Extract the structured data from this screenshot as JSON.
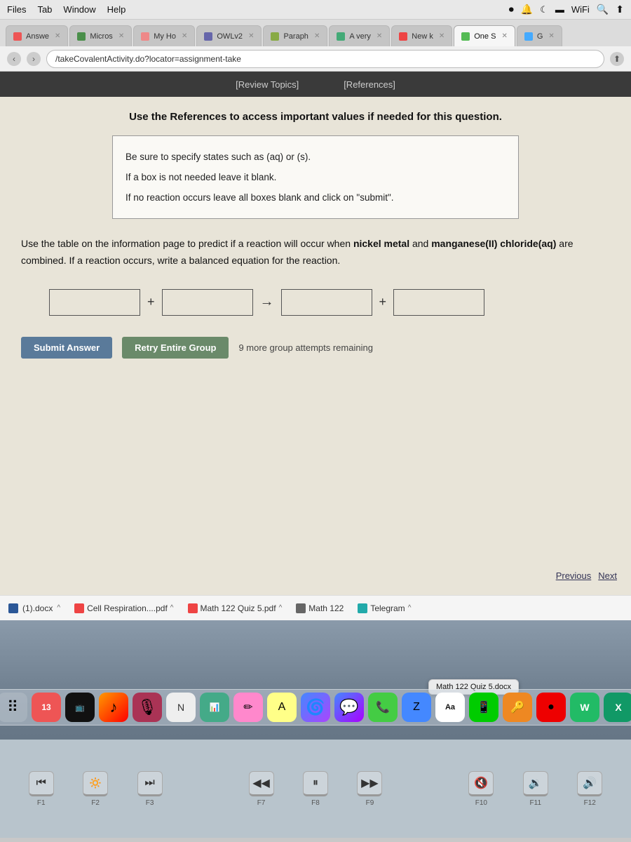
{
  "menubar": {
    "items": [
      "Files",
      "Tab",
      "Window",
      "Help"
    ]
  },
  "tabs": [
    {
      "id": "answe",
      "label": "Answe",
      "active": false,
      "favicon": "A"
    },
    {
      "id": "micros",
      "label": "Micros",
      "active": false,
      "favicon": "M"
    },
    {
      "id": "myho",
      "label": "My Ho",
      "active": false,
      "favicon": "H"
    },
    {
      "id": "owlv",
      "label": "OWLv2",
      "active": false,
      "favicon": "O"
    },
    {
      "id": "paraph",
      "label": "Paraph",
      "active": false,
      "favicon": "P"
    },
    {
      "id": "avery",
      "label": "A very",
      "active": false,
      "favicon": "A"
    },
    {
      "id": "newk",
      "label": "New k",
      "active": false,
      "favicon": "N"
    },
    {
      "id": "ones",
      "label": "One S",
      "active": true,
      "favicon": "E"
    },
    {
      "id": "g",
      "label": "G",
      "active": false,
      "favicon": "G"
    }
  ],
  "address_bar": {
    "url": "/takeCovalentActivity.do?locator=assignment-take"
  },
  "owl_toolbar": {
    "review_topics": "[Review Topics]",
    "references": "[References]"
  },
  "page": {
    "instruction_header": "Use the References to access important values if needed for this question.",
    "instructions": [
      "Be sure to specify states such as (aq) or (s).",
      "If a box is not needed leave it blank.",
      "If no reaction occurs leave all boxes blank and click on \"submit\"."
    ],
    "question_text_part1": "Use the table on the information page to predict if a reaction will occur when ",
    "question_bold1": "nickel metal",
    "question_text_part2": " and ",
    "question_bold2": "manganese(II) chloride(aq)",
    "question_text_part3": " are combined. If a reaction occurs, write a balanced equation for the reaction.",
    "equation": {
      "plus1": "+",
      "arrow": "→",
      "plus2": "+"
    },
    "buttons": {
      "submit": "Submit Answer",
      "retry": "Retry Entire Group",
      "attempts": "9 more group attempts remaining"
    },
    "navigation": {
      "previous": "Previous",
      "next": "Next"
    }
  },
  "download_bar": {
    "items": [
      {
        "label": "(1).docx",
        "icon": "W"
      },
      {
        "label": "Cell Respiration....pdf",
        "icon": "PDF"
      },
      {
        "label": "Math 122 Quiz 5.pdf",
        "icon": "PDF"
      },
      {
        "label": "Math 122",
        "icon": "□"
      },
      {
        "label": "Telegram",
        "icon": "T"
      }
    ]
  },
  "dock_tooltip": {
    "text": "Math 122 Quiz 5.docx"
  },
  "dock": {
    "items": [
      {
        "icon": "⠿",
        "label": "grid"
      },
      {
        "icon": "📅",
        "label": "calendar"
      },
      {
        "icon": "📺",
        "label": "tv"
      },
      {
        "icon": "🎵",
        "label": "music"
      },
      {
        "icon": "🎙",
        "label": "podcast"
      },
      {
        "icon": "📝",
        "label": "notes"
      },
      {
        "icon": "📊",
        "label": "numbers"
      },
      {
        "icon": "✏️",
        "label": "pencil"
      },
      {
        "icon": "🔡",
        "label": "font"
      },
      {
        "icon": "🌀",
        "label": "arc"
      },
      {
        "icon": "💬",
        "label": "messages"
      },
      {
        "icon": "🔊",
        "label": "whatsapp"
      },
      {
        "icon": "🐦",
        "label": "bird"
      },
      {
        "icon": "🅰",
        "label": "font2"
      },
      {
        "icon": "📷",
        "label": "camera"
      },
      {
        "icon": "🔑",
        "label": "key"
      },
      {
        "icon": "🔵",
        "label": "circle"
      },
      {
        "icon": "🌐",
        "label": "globe"
      },
      {
        "icon": "📘",
        "label": "word"
      }
    ]
  },
  "keyboard_shortcuts": [
    {
      "icon": "⏮",
      "key": "F1"
    },
    {
      "icon": "🔅",
      "key": "F2"
    },
    {
      "icon": "⏭",
      "key": "F3"
    },
    {
      "icon": "◀◀",
      "key": "F7"
    },
    {
      "icon": "⏸▶",
      "key": "F8"
    },
    {
      "icon": "▶▶",
      "key": "F9"
    },
    {
      "icon": "🔇",
      "key": "F10"
    },
    {
      "icon": "🔉",
      "key": "F11"
    },
    {
      "icon": "🔊",
      "key": "F12"
    }
  ]
}
